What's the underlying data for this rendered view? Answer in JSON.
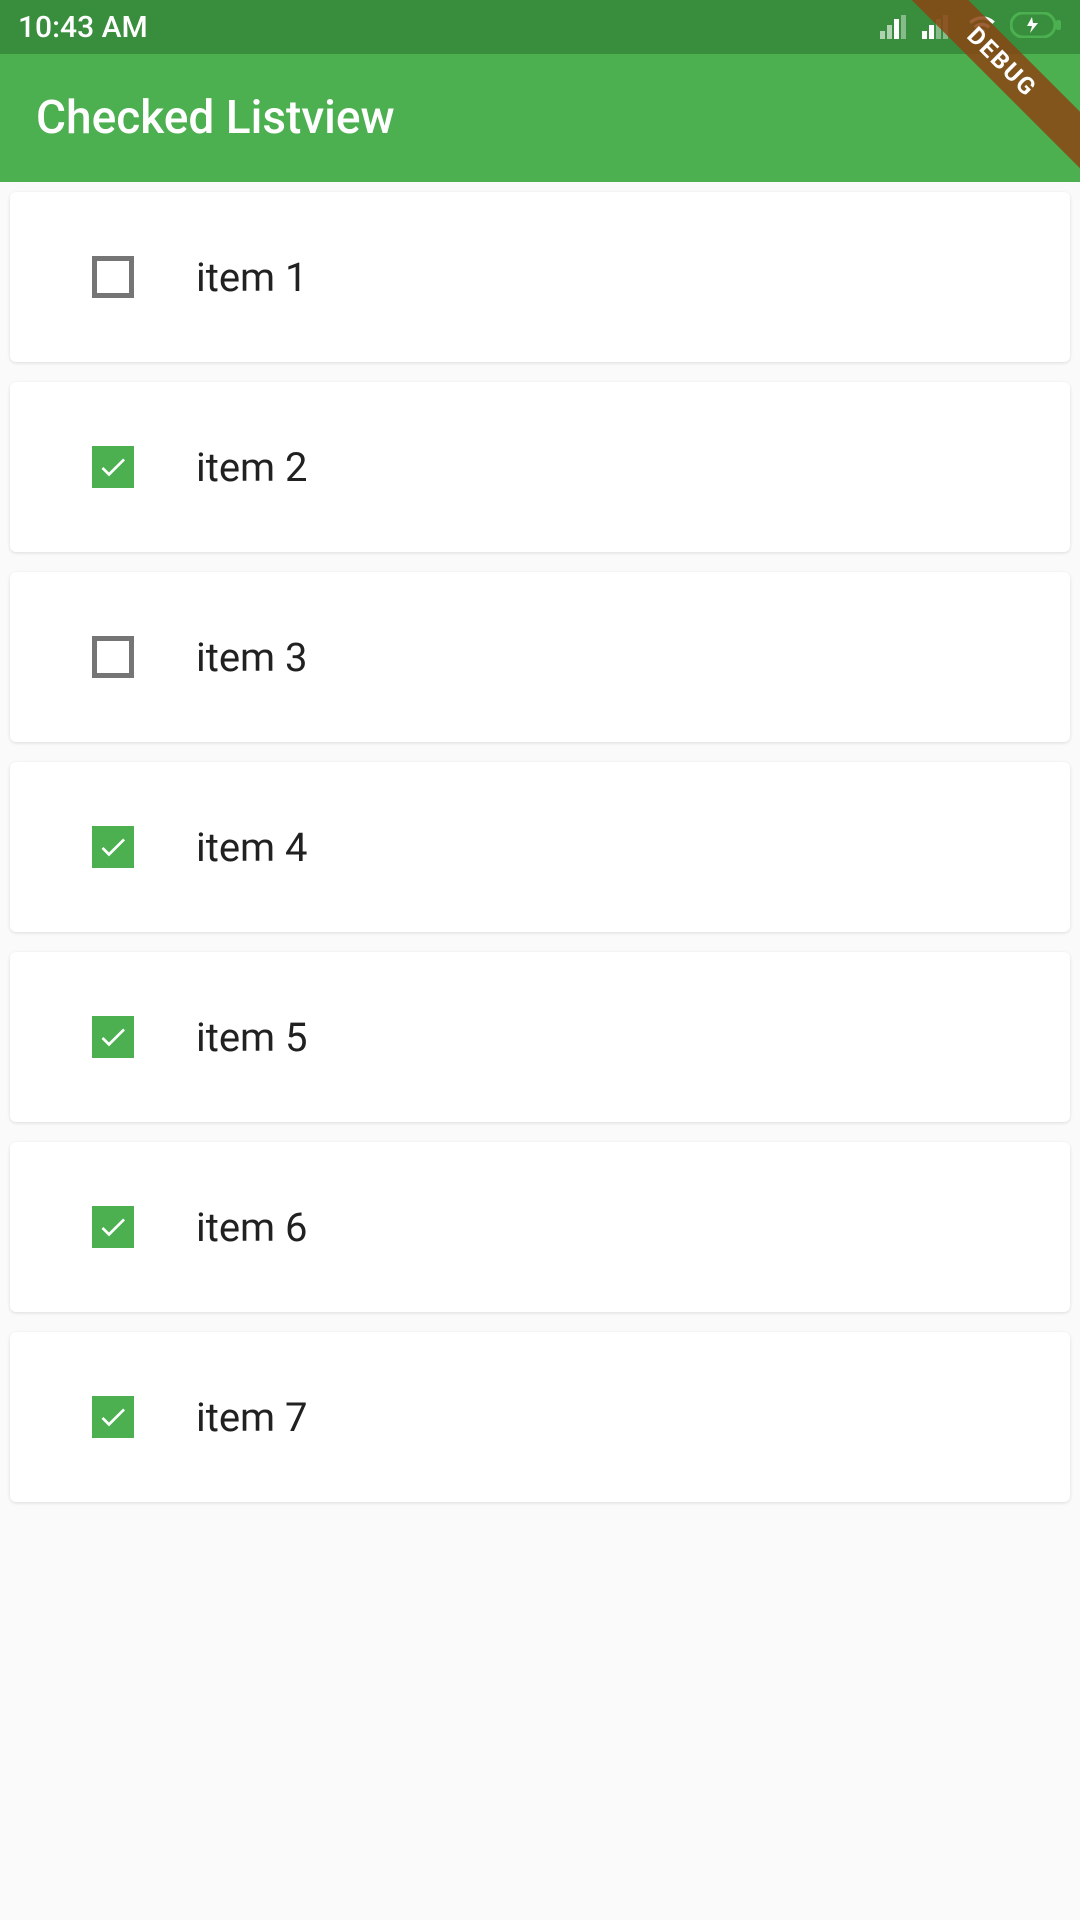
{
  "status_bar": {
    "time": "10:43 AM"
  },
  "app_bar": {
    "title": "Checked Listview"
  },
  "debug_banner": {
    "label": "DEBUG"
  },
  "list": {
    "items": [
      {
        "label": "item 1",
        "checked": false
      },
      {
        "label": "item 2",
        "checked": true
      },
      {
        "label": "item 3",
        "checked": false
      },
      {
        "label": "item 4",
        "checked": true
      },
      {
        "label": "item 5",
        "checked": true
      },
      {
        "label": "item 6",
        "checked": true
      },
      {
        "label": "item 7",
        "checked": true
      }
    ]
  },
  "colors": {
    "primary": "#4caf50",
    "primary_dark": "#388e3c",
    "checkbox_border": "#757575"
  }
}
